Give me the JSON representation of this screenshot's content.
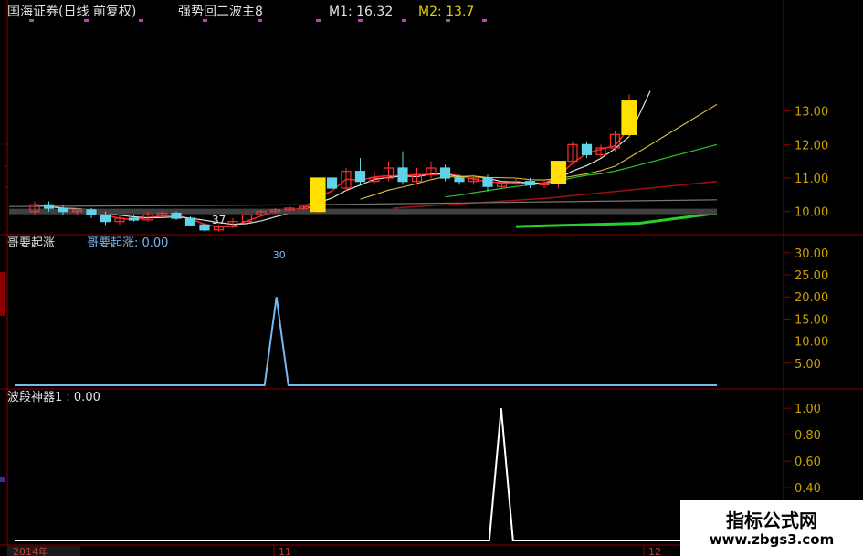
{
  "header": {
    "stock": "国海证券(日线 前复权)",
    "indicator": "强势回二波主8",
    "m1_label": "M1: 16.32",
    "m2_label": "M2: 13.7"
  },
  "colors": {
    "bg": "#000000",
    "border": "#8b0000",
    "axis_text": "#c8a000",
    "up_candle": "#ff3030",
    "down_candle": "#5fd4e8",
    "signal_bar": "#ffe000",
    "ind1_line": "#79b8f0",
    "ind2_line": "#ffffff"
  },
  "price_panel": {
    "ylim": [
      9.5,
      15.5
    ],
    "ticks": [
      "10.00",
      "11.00",
      "12.00",
      "13.00"
    ],
    "low_label": "37",
    "candles": [
      [
        10.0,
        10.2,
        9.9,
        10.3
      ],
      [
        10.2,
        10.1,
        10.0,
        10.3
      ],
      [
        10.1,
        10.0,
        9.9,
        10.2
      ],
      [
        10.0,
        10.05,
        9.9,
        10.1
      ],
      [
        10.05,
        9.9,
        9.8,
        10.1
      ],
      [
        9.9,
        9.7,
        9.6,
        10.0
      ],
      [
        9.7,
        9.8,
        9.6,
        9.9
      ],
      [
        9.8,
        9.75,
        9.7,
        9.9
      ],
      [
        9.75,
        9.9,
        9.7,
        10.0
      ],
      [
        9.9,
        9.95,
        9.85,
        10.0
      ],
      [
        9.95,
        9.8,
        9.75,
        10.0
      ],
      [
        9.8,
        9.6,
        9.55,
        9.85
      ],
      [
        9.6,
        9.45,
        9.4,
        9.65
      ],
      [
        9.45,
        9.55,
        9.4,
        9.6
      ],
      [
        9.55,
        9.7,
        9.5,
        9.8
      ],
      [
        9.7,
        9.9,
        9.6,
        10.0
      ],
      [
        9.9,
        10.0,
        9.85,
        10.05
      ],
      [
        10.0,
        10.05,
        9.95,
        10.1
      ],
      [
        10.05,
        10.1,
        10.0,
        10.15
      ],
      [
        10.1,
        10.15,
        10.05,
        10.2
      ],
      [
        10.0,
        11.0,
        9.95,
        11.0
      ],
      [
        11.0,
        10.7,
        10.5,
        11.1
      ],
      [
        10.7,
        11.2,
        10.6,
        11.3
      ],
      [
        11.2,
        10.9,
        10.8,
        11.6
      ],
      [
        10.9,
        11.0,
        10.8,
        11.2
      ],
      [
        11.0,
        11.3,
        10.9,
        11.5
      ],
      [
        11.3,
        10.9,
        10.8,
        11.8
      ],
      [
        10.9,
        11.1,
        10.8,
        11.3
      ],
      [
        11.1,
        11.3,
        11.0,
        11.5
      ],
      [
        11.3,
        11.0,
        10.9,
        11.4
      ],
      [
        11.0,
        10.9,
        10.8,
        11.1
      ],
      [
        10.9,
        11.0,
        10.8,
        11.1
      ],
      [
        11.0,
        10.75,
        10.6,
        11.1
      ],
      [
        10.75,
        10.85,
        10.7,
        10.9
      ],
      [
        10.85,
        10.9,
        10.8,
        11.0
      ],
      [
        10.9,
        10.8,
        10.7,
        11.0
      ],
      [
        10.8,
        10.85,
        10.7,
        10.95
      ],
      [
        10.85,
        11.5,
        10.7,
        11.5
      ],
      [
        11.5,
        12.0,
        11.4,
        12.1
      ],
      [
        12.0,
        11.7,
        11.6,
        12.1
      ],
      [
        11.7,
        11.9,
        11.6,
        12.0
      ],
      [
        11.9,
        12.3,
        11.8,
        12.4
      ],
      [
        12.3,
        13.3,
        12.2,
        13.5
      ]
    ],
    "signal_bar_indices": [
      20,
      37,
      42
    ]
  },
  "indicator1": {
    "title": "哥要起涨",
    "value_label": "哥要起涨: 0.00",
    "ticks": [
      "5.00",
      "10.00",
      "15.00",
      "20.00",
      "25.00",
      "30.00"
    ],
    "ylim": [
      0,
      31
    ],
    "values": [
      0,
      0,
      0,
      0,
      0,
      0,
      0,
      0,
      0,
      0,
      0,
      0,
      0,
      0,
      0,
      0,
      0,
      0,
      0,
      0,
      0,
      0,
      20,
      0,
      0,
      0,
      0,
      0,
      0,
      0,
      0,
      0,
      0,
      0,
      0,
      0,
      0,
      0,
      0,
      0,
      0,
      0,
      0,
      0,
      0,
      0,
      0,
      0,
      0,
      0,
      0,
      0,
      0,
      0,
      0,
      0,
      0,
      0,
      0,
      0
    ],
    "spike_marker": "30"
  },
  "indicator2": {
    "value_label": "波段神器1 : 0.00",
    "ticks": [
      "0.40",
      "0.60",
      "0.80",
      "1.00"
    ],
    "ylim": [
      0,
      1.05
    ],
    "values": [
      0,
      0,
      0,
      0,
      0,
      0,
      0,
      0,
      0,
      0,
      0,
      0,
      0,
      0,
      0,
      0,
      0,
      0,
      0,
      0,
      0,
      0,
      0,
      0,
      0,
      0,
      0,
      0,
      0,
      0,
      0,
      0,
      0,
      0,
      0,
      0,
      0,
      0,
      0,
      0,
      0,
      1,
      0,
      0,
      0,
      0,
      0,
      0,
      0,
      0,
      0,
      0,
      0,
      0,
      0,
      0,
      0,
      0,
      0,
      0
    ]
  },
  "time_axis": {
    "labels": [
      "2014年",
      "11",
      "12"
    ]
  },
  "watermark": {
    "line1": "指标公式网",
    "line2": "www.zbgs3.com"
  }
}
